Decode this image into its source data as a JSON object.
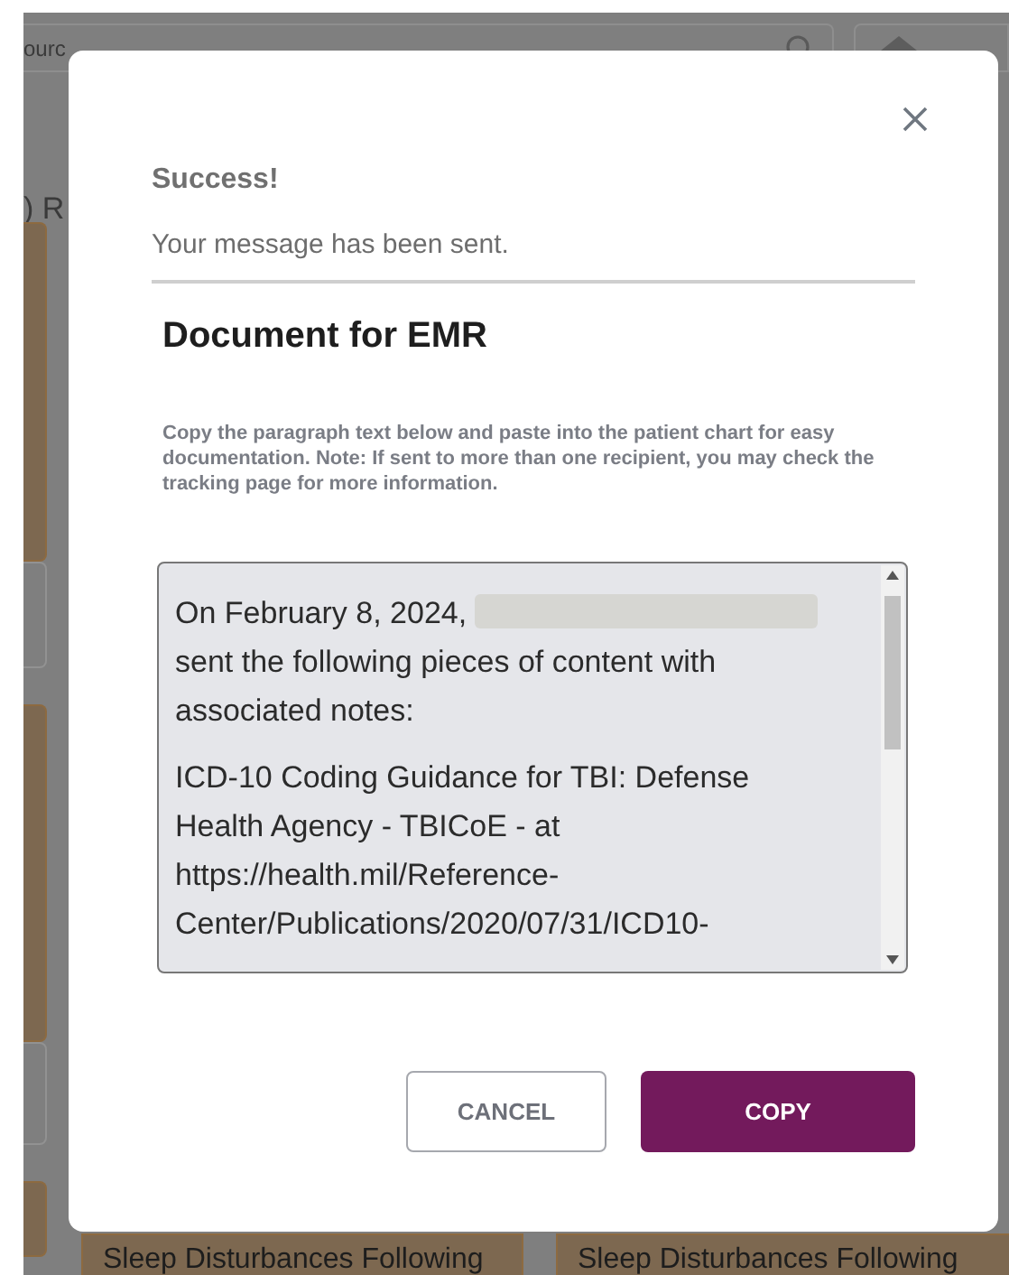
{
  "background": {
    "search_field": {
      "value": "ourc"
    },
    "heading": ") R",
    "cards": [
      {
        "title": "Sleep Disturbances Following"
      },
      {
        "title": "Sleep Disturbances Following"
      }
    ]
  },
  "dialog": {
    "status_title": "Success!",
    "status_message": "Your message has been sent.",
    "title": "Document for EMR",
    "instructions": "Copy the paragraph text below and paste into the patient chart for easy documentation. Note: If sent to more than one recipient, you may check the tracking page for more information.",
    "textbox": {
      "paragraphs": [
        {
          "lines": [
            {
              "text": "On February 8, 2024,",
              "redacted": true
            },
            {
              "text": "sent the following pieces of content with associated notes:",
              "redacted": false
            }
          ]
        },
        {
          "lines": [
            {
              "text": "ICD-10 Coding Guidance for TBI: Defense Health Agency - TBICoE - at https://health.mil/Reference-Center/Publications/2020/07/31/ICD10-",
              "redacted": false
            }
          ]
        }
      ]
    },
    "buttons": [
      {
        "label": "CANCEL",
        "kind": "secondary"
      },
      {
        "label": "COPY",
        "kind": "primary"
      }
    ]
  }
}
